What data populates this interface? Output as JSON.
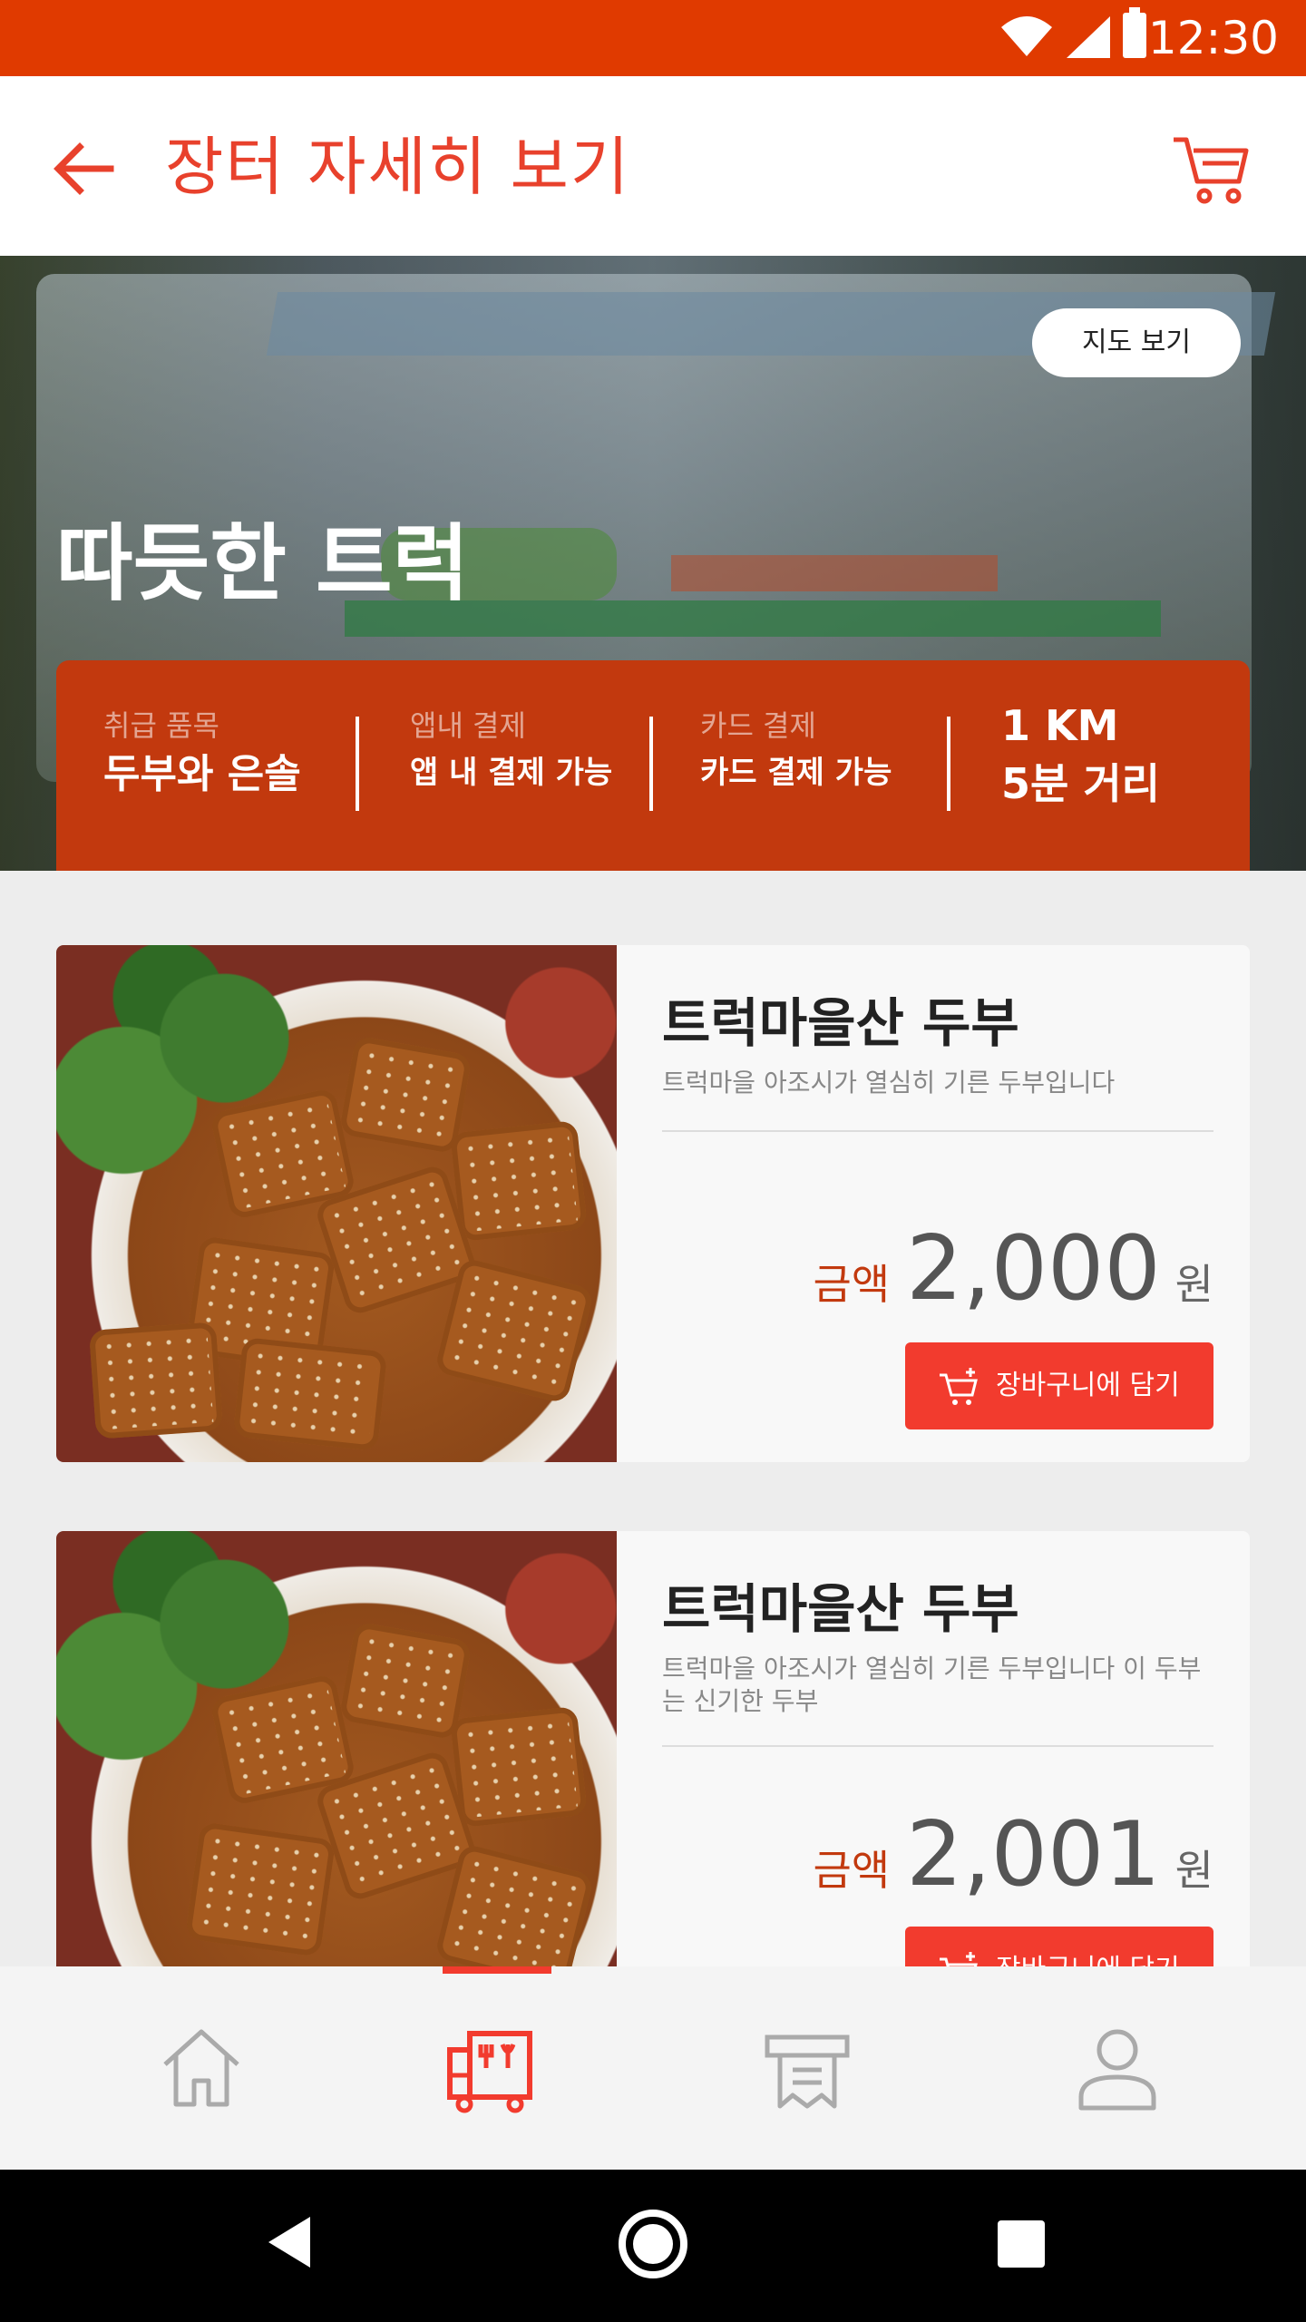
{
  "status_bar": {
    "time": "12:30"
  },
  "header": {
    "title": "장터 자세히 보기"
  },
  "hero": {
    "title": "따듯한 트럭",
    "map_button": "지도 보기",
    "info": {
      "items_label": "취급 품목",
      "items_value": "두부와 은솔",
      "app_pay_label": "앱내 결제",
      "app_pay_value": "앱 내 결제 가능",
      "card_pay_label": "카드 결제",
      "card_pay_value": "카드 결제 가능",
      "distance": "1 KM",
      "walk_time": "5분 거리"
    }
  },
  "products": [
    {
      "name": "트럭마을산 두부",
      "description": "트럭마을 아조시가 열심히 기른 두부입니다",
      "price_label": "금액",
      "price": "2,000",
      "unit": "원",
      "button": "장바구니에 담기"
    },
    {
      "name": "트럭마을산 두부",
      "description": "트럭마을 아조시가 열심히 기른 두부입니다 이 두부는 신기한 두부",
      "price_label": "금액",
      "price": "2,001",
      "unit": "원",
      "button": "장바구니에 담기"
    }
  ],
  "bottom_nav": {
    "items": [
      "home-icon",
      "market-truck-icon",
      "receipt-icon",
      "profile-icon"
    ],
    "active_index": 1
  },
  "colors": {
    "status_bar": "#e03a00",
    "accent": "#f23b2e",
    "info_card": "#c2390e",
    "title": "#e8412c"
  }
}
